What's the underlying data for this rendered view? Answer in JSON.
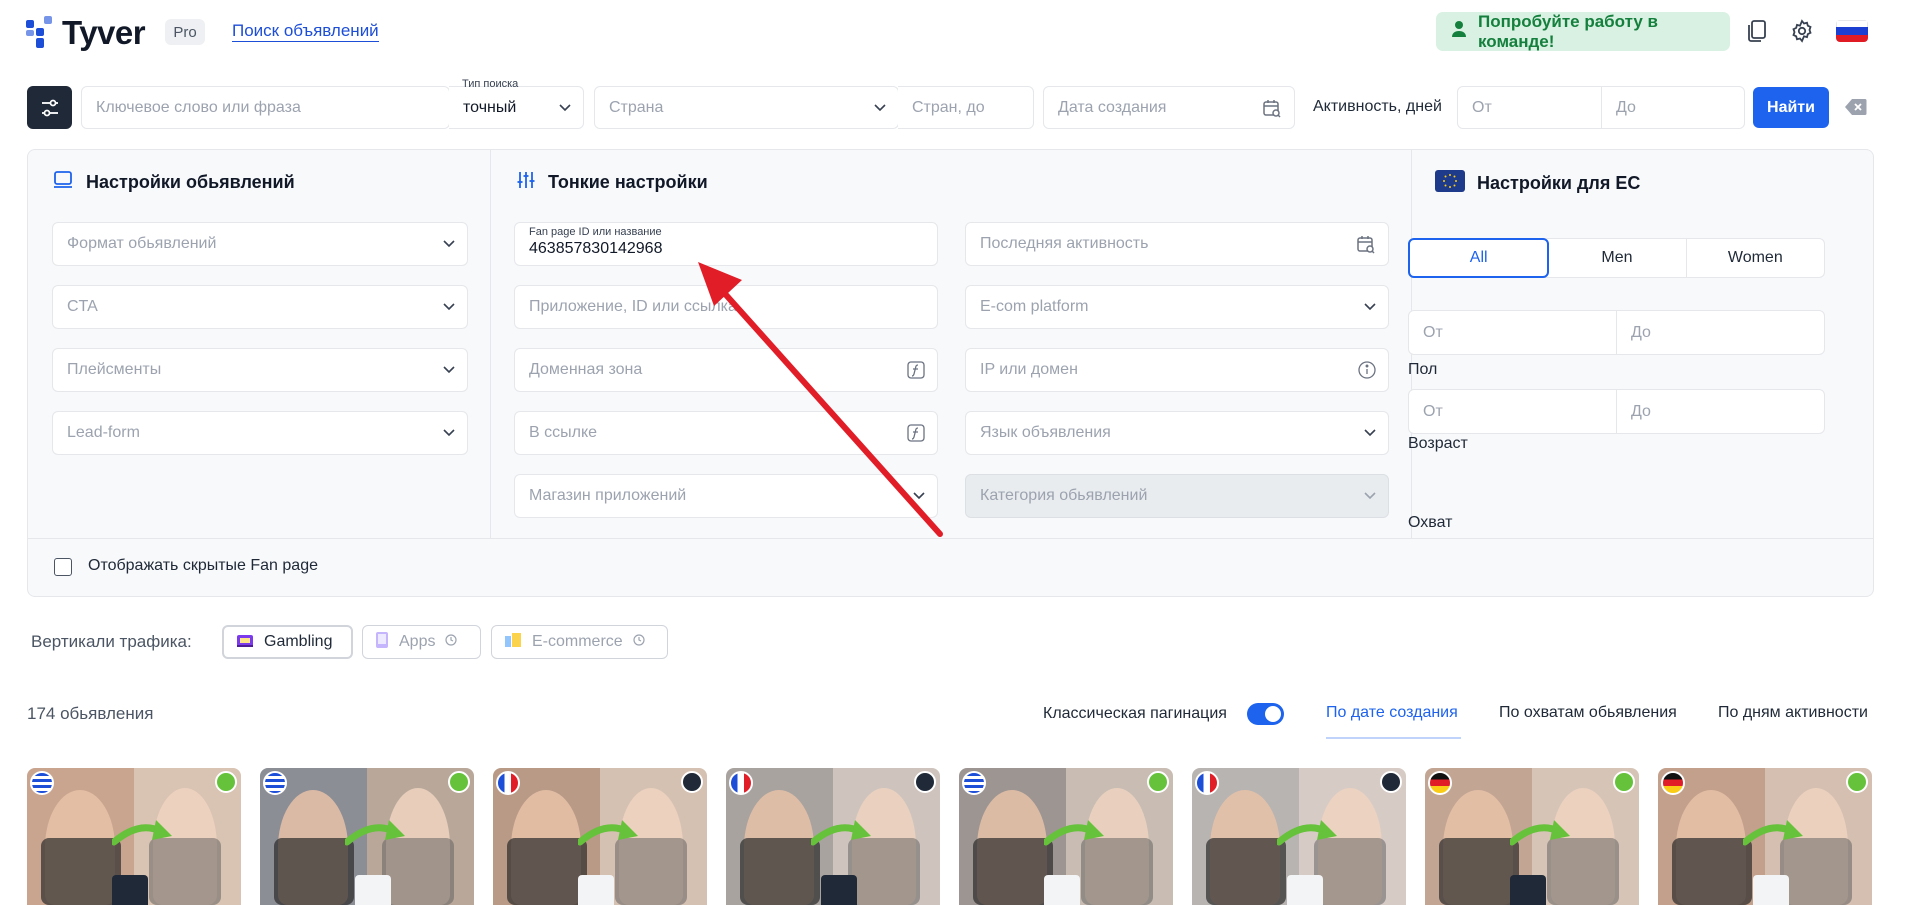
{
  "header": {
    "brand": "Tyver",
    "badge": "Pro",
    "nav_link": "Поиск объявлений",
    "team_button": "Попробуйте работу в команде!",
    "icons": [
      "book-icon",
      "gear-icon",
      "flag-ru-icon"
    ]
  },
  "search": {
    "keyword_placeholder": "Ключевое слово или фраза",
    "search_type_label": "Тип поиска",
    "search_type_value": "точный",
    "country_placeholder": "Страна",
    "country_to_placeholder": "Стран, до",
    "date_placeholder": "Дата создания",
    "activity_label": "Активность, дней",
    "from_placeholder": "От",
    "to_placeholder": "До",
    "find_button": "Найти"
  },
  "ad_settings": {
    "title": "Настройки обьявлений",
    "fields": [
      "Формат обьявлений",
      "CTA",
      "Плейсменты",
      "Lead-form"
    ]
  },
  "fine_settings": {
    "title": "Тонкие настройки",
    "fanpage_label": "Fan page ID или название",
    "fanpage_value": "463857830142968",
    "app_placeholder": "Приложение, ID или ссылка",
    "domain_zone_placeholder": "Доменная зона",
    "in_link_placeholder": "В ссылке",
    "app_store_placeholder": "Магазин приложений",
    "last_activity_placeholder": "Последняя активность",
    "ecom_placeholder": "E-com platform",
    "ip_domain_placeholder": "IP или домен",
    "language_placeholder": "Язык объявления",
    "category_placeholder": "Категория обьявлений"
  },
  "eu_settings": {
    "title": "Настройки для ЕС",
    "gender_label": "Пол",
    "gender_options": [
      "All",
      "Men",
      "Women"
    ],
    "gender_selected": "All",
    "age_label": "Возраст",
    "reach_label": "Охват",
    "from": "От",
    "to": "До"
  },
  "hidden_fanpage_label": "Отображать скрытые Fan page",
  "verticals": {
    "label": "Вертикали трафика:",
    "items": [
      "Gambling",
      "Apps",
      "E-commerce"
    ]
  },
  "results": {
    "count": "174 обьявления",
    "pagination_label": "Классическая пагинация",
    "pagination_enabled": true,
    "sort_options": [
      "По дате создания",
      "По охватам обьявления",
      "По дням активности"
    ],
    "sort_selected": "По дате создания"
  },
  "cards": [
    {
      "flag": "GR",
      "badge": "organic"
    },
    {
      "flag": "GR",
      "badge": "organic"
    },
    {
      "flag": "FR",
      "badge": "leaf"
    },
    {
      "flag": "FR",
      "badge": "leaf"
    },
    {
      "flag": "GR",
      "badge": "organic"
    },
    {
      "flag": "FR",
      "badge": "leaf"
    },
    {
      "flag": "DE",
      "badge": "organic"
    },
    {
      "flag": "DE",
      "badge": "organic"
    }
  ],
  "colors": {
    "accent": "#1d63ed",
    "team_bg": "#d8f1e2",
    "team_text": "#15803d",
    "annotation": "#e11d27"
  }
}
